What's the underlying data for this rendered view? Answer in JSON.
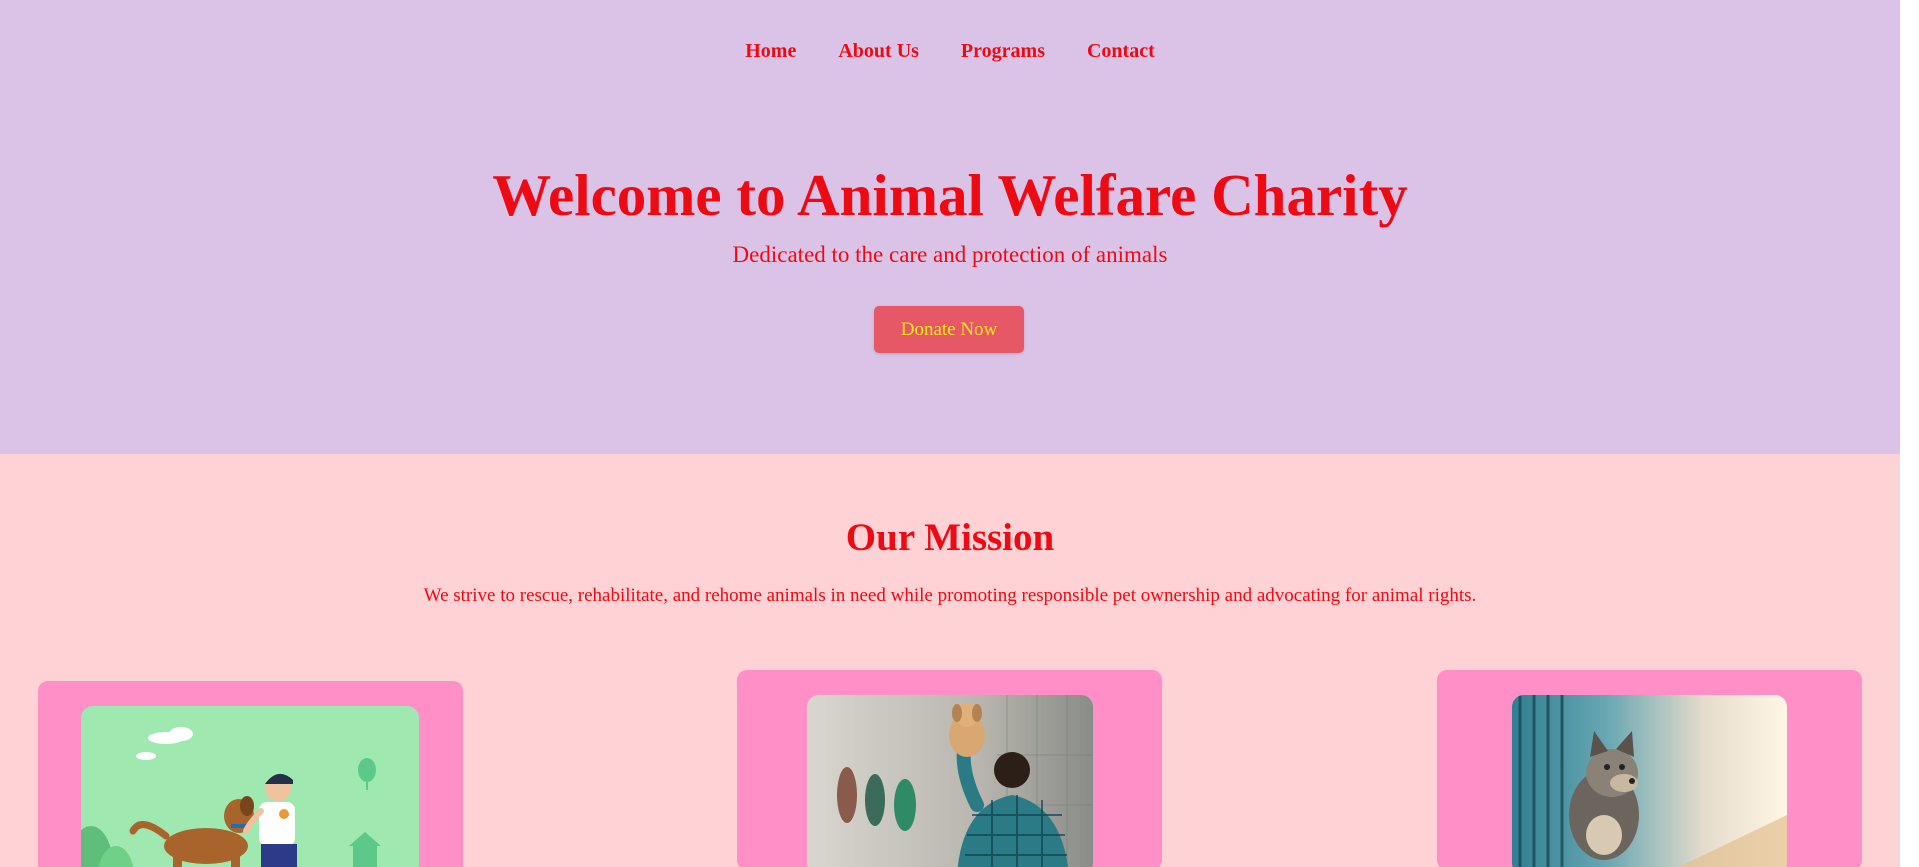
{
  "nav": {
    "items": [
      "Home",
      "About Us",
      "Programs",
      "Contact"
    ]
  },
  "hero": {
    "title": "Welcome to Animal Welfare Charity",
    "subtitle": "Dedicated to the care and protection of animals",
    "donate_label": "Donate Now"
  },
  "mission": {
    "title": "Our Mission",
    "text": "We strive to rescue, rehabilitate, and rehome animals in need while promoting responsible pet ownership and advocating for animal rights."
  },
  "colors": {
    "hero_bg": "#dbc3e7",
    "mission_bg": "#ffd2d6",
    "card_bg": "#ff8fc6",
    "text_red": "#ee0a12",
    "button_bg": "#e65866",
    "button_text": "#ffe81a"
  },
  "scrollbar": {
    "up_icon": "arrow-up-icon",
    "down_icon": "arrow-down-icon"
  }
}
